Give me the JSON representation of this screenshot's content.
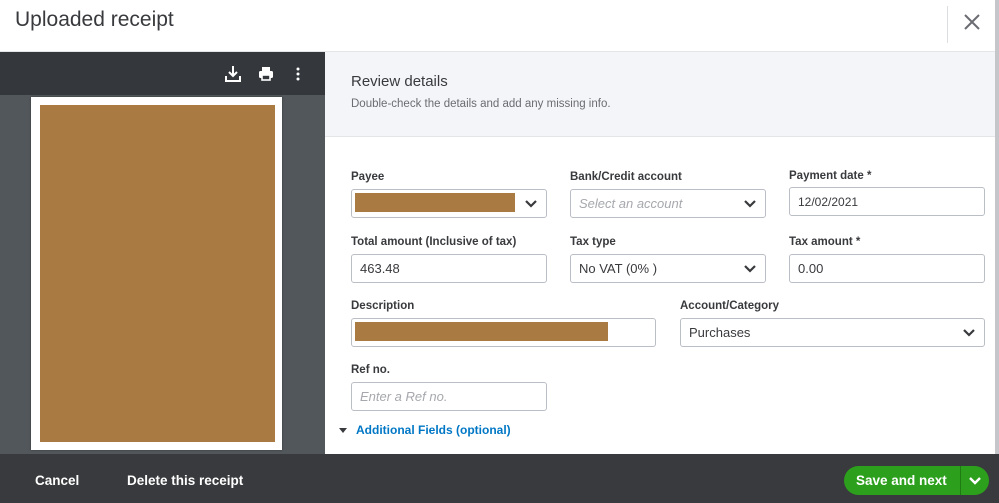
{
  "header": {
    "title": "Uploaded receipt",
    "close_icon": "close-icon"
  },
  "viewer": {
    "toolbar_icons": [
      "download-icon",
      "print-icon",
      "more-vertical-icon"
    ],
    "document_redacted": true
  },
  "review": {
    "title": "Review details",
    "subtitle": "Double-check the details and add any missing info."
  },
  "form": {
    "payee": {
      "label": "Payee",
      "value_redacted": true
    },
    "bank_account": {
      "label": "Bank/Credit account",
      "placeholder": "Select an account"
    },
    "payment_date": {
      "label": "Payment date *",
      "value": "12/02/2021"
    },
    "total_amount": {
      "label": "Total amount (Inclusive of tax)",
      "value": "463.48"
    },
    "tax_type": {
      "label": "Tax type",
      "value": "No VAT (0% )"
    },
    "tax_amount": {
      "label": "Tax amount *",
      "value": "0.00"
    },
    "description": {
      "label": "Description",
      "value_redacted": true
    },
    "account_category": {
      "label": "Account/Category",
      "value": "Purchases"
    },
    "ref_no": {
      "label": "Ref no.",
      "placeholder": "Enter a Ref no."
    },
    "additional_fields": "Additional Fields (optional)"
  },
  "footer": {
    "cancel": "Cancel",
    "delete": "Delete this receipt",
    "save_next": "Save and next"
  },
  "colors": {
    "accent_green": "#2ca01c",
    "link_blue": "#0077c5",
    "redaction": "#a97a42"
  }
}
